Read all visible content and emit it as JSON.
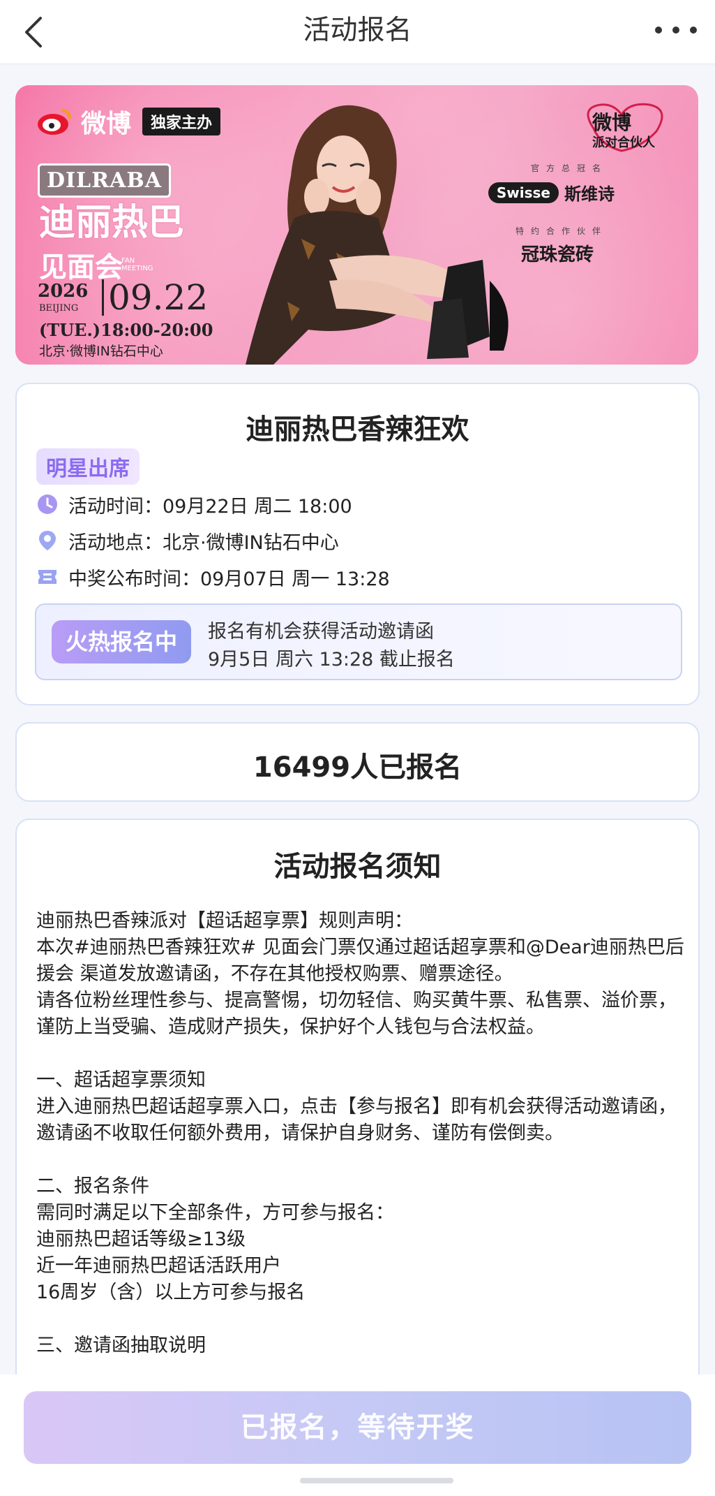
{
  "nav": {
    "title": "活动报名",
    "back_icon": "chevron-left-icon",
    "more_icon": "more-dots-icon"
  },
  "banner": {
    "weibo_text": "微博",
    "host_tag": "独家主办",
    "dilraba_logo": "DILRABA",
    "dilraba_sub": "",
    "title_line1": "迪丽热巴",
    "title_line2": "见面会",
    "fan_meeting": "FAN MEETING",
    "year": "2026",
    "city_en": "BEIJING",
    "date": "09.22",
    "time": "(TUE.)18:00-20:00",
    "venue": "北京·微博IN钻石中心",
    "party_line1": "微博",
    "party_line2": "派对合伙人",
    "sponsor_label1": "官方总冠名",
    "swisse_en": "Swisse",
    "swisse_cn": "斯维诗",
    "sponsor_label2": "特约合作伙伴",
    "partner2": "冠珠瓷砖"
  },
  "event": {
    "title": "迪丽热巴香辣狂欢",
    "star_tag": "明星出席",
    "time_label": "活动时间：09月22日 周二 18:00",
    "place_label": "活动地点：北京·微博IN钻石中心",
    "announce_label": "中奖公布时间：09月07日 周一 13:28",
    "hot_tag": "火热报名中",
    "hot_line1": "报名有机会获得活动邀请函",
    "hot_line2": "9月5日 周六 13:28 截止报名"
  },
  "count": {
    "text": "16499人已报名"
  },
  "notice": {
    "title": "活动报名须知",
    "paragraphs": [
      "迪丽热巴香辣派对【超话超享票】规则声明：\n本次#迪丽热巴香辣狂欢# 见面会门票仅通过超话超享票和@Dear迪丽热巴后援会 渠道发放邀请函，不存在其他授权购票、赠票途径。\n请各位粉丝理性参与、提高警惕，切勿轻信、购买黄牛票、私售票、溢价票，谨防上当受骗、造成财产损失，保护好个人钱包与合法权益。",
      "一、超话超享票须知\n进入迪丽热巴超话超享票入口，点击【参与报名】即有机会获得活动邀请函，\n邀请函不收取任何额外费用，请保护自身财务、谨防有偿倒卖。",
      "二、报名条件\n需同时满足以下全部条件，方可参与报名：\n迪丽热巴超话等级≥13级\n近一年迪丽热巴超话活跃用户\n16周岁（含）以上方可参与报名",
      "三、邀请函抽取说明"
    ]
  },
  "cta": {
    "label": "已报名，等待开奖"
  },
  "colors": {
    "accent": "#8f9bf0",
    "banner_pink": "#f58cb5",
    "star_tag": "#8b6cf0"
  }
}
